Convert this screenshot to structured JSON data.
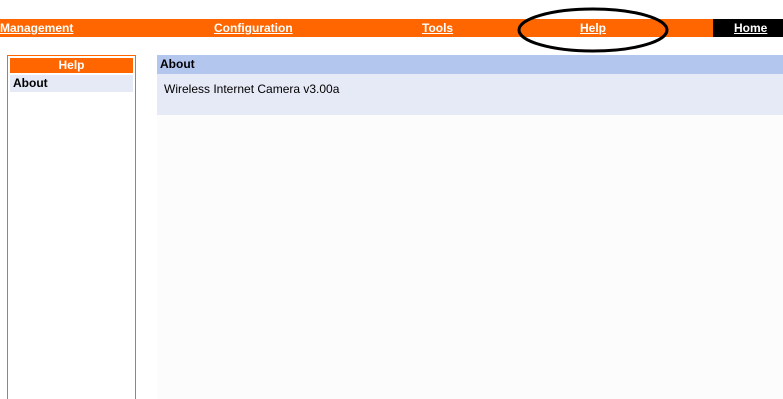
{
  "nav": {
    "management": "Management",
    "configuration": "Configuration",
    "tools": "Tools",
    "help": "Help",
    "home": "Home"
  },
  "sidebar": {
    "header": "Help",
    "items": [
      {
        "label": "About"
      }
    ]
  },
  "main": {
    "section_title": "About",
    "about_text": "Wireless Internet Camera v3.00a"
  },
  "colors": {
    "accent": "#ff6600",
    "section_header": "#b3c6ee",
    "section_body": "#e6e9f6",
    "home_bg": "#000000"
  },
  "annotation": {
    "shape": "ellipse",
    "target": "help-link",
    "color": "#000000"
  }
}
